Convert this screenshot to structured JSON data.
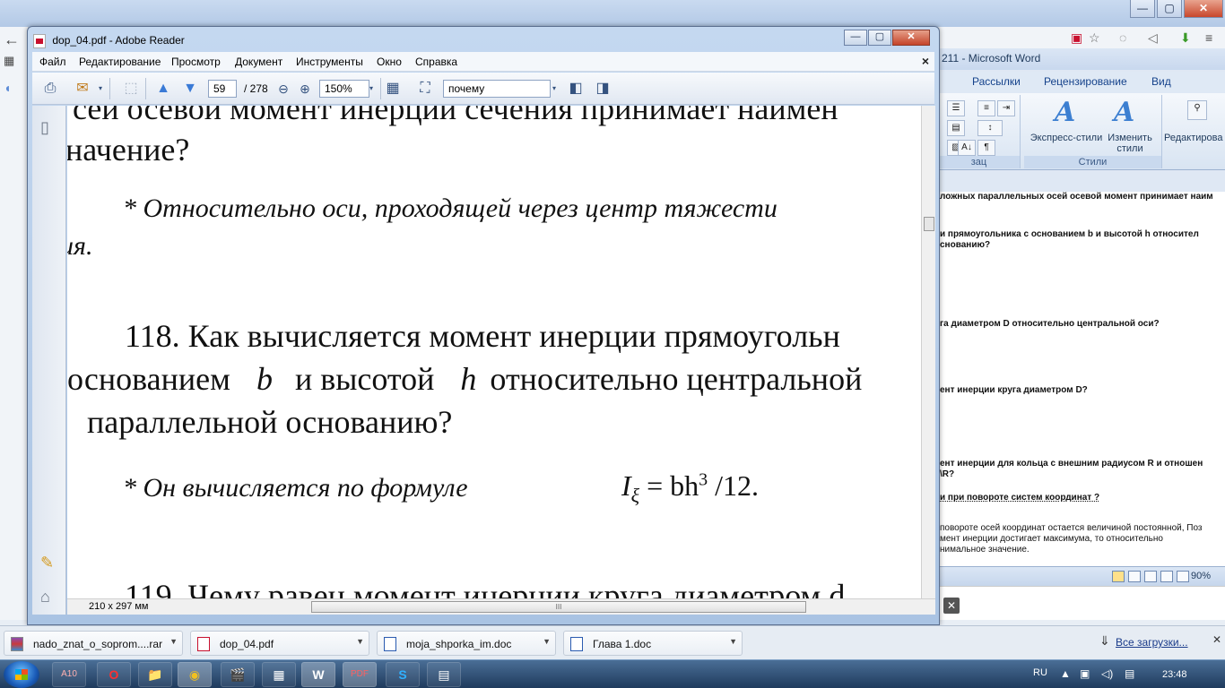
{
  "chrome": {
    "controls": [
      "—",
      "▢",
      "✕"
    ]
  },
  "word": {
    "title": "211 - Microsoft Word",
    "tabs": [
      "Рассылки",
      "Рецензирование",
      "Вид"
    ],
    "ribbon": {
      "express_styles": "Экспресс-стили",
      "change_styles": "Изменить стили",
      "editing": "Редактирова",
      "styles_group": "Стили",
      "para_group": "зац"
    },
    "doc_lines": [
      "ложных параллельных осей осевой момент принимает наим",
      "и прямоугольника с основанием b и высотой h относител",
      "снованию?",
      "га диаметром D относительно центральной оси?",
      "ент инерции круга диаметром D?",
      "ент инерции для кольца с внешним радиусом R и отношен",
      "\\R?",
      "и при повороте систем координат ?",
      "повороте осей координат остается величиной постоянной, Поз",
      "мент инерции достигает  максимума, то относительно",
      "нимальное значение."
    ],
    "zoom": "90%"
  },
  "reader": {
    "title": "dop_04.pdf - Adobe Reader",
    "controls": [
      "—",
      "▢",
      "✕"
    ],
    "menu": [
      "Файл",
      "Редактирование",
      "Просмотр",
      "Документ",
      "Инструменты",
      "Окно",
      "Справка"
    ],
    "menu_close": "×",
    "page_current": "59",
    "page_total": "/ 278",
    "zoom": "150%",
    "search_value": "почему",
    "page_size": "210 x 297 мм",
    "page_text": {
      "line1": "сей осевой момент инерции сечения принимает наимен",
      "line2": "начение?",
      "line3": "* Относительно оси, проходящей через центр тяжести",
      "line4": "ия.",
      "q118_a": "118. Как вычисляется момент инерции прямоугольн",
      "q118_b": "основанием",
      "q118_b_var": "b",
      "q118_c": "и высотой",
      "q118_c_var": "h",
      "q118_d": "относительно центральной",
      "q118_e": "параллельной основанию?",
      "ans118": "* Он вычисляется по формуле",
      "formula_I": "I",
      "formula_sub": "ξ",
      "formula_rest": "= bh",
      "formula_sup": "3",
      "formula_end": "/12.",
      "q119": "119. Чему равен момент инерции круга диаметром d"
    }
  },
  "downloads": {
    "items": [
      "nado_znat_o_soprom....rar",
      "dop_04.pdf",
      "moja_shporka_im.doc",
      "Глава 1.doc"
    ],
    "all_label": "Все загрузки...",
    "close": "✕"
  },
  "taskbar": {
    "lang": "RU",
    "time": "23:48",
    "apps": [
      "A10",
      "O",
      "📁",
      "◉",
      "🎬",
      "▦",
      "W",
      "PDF",
      "S",
      "▤"
    ]
  }
}
